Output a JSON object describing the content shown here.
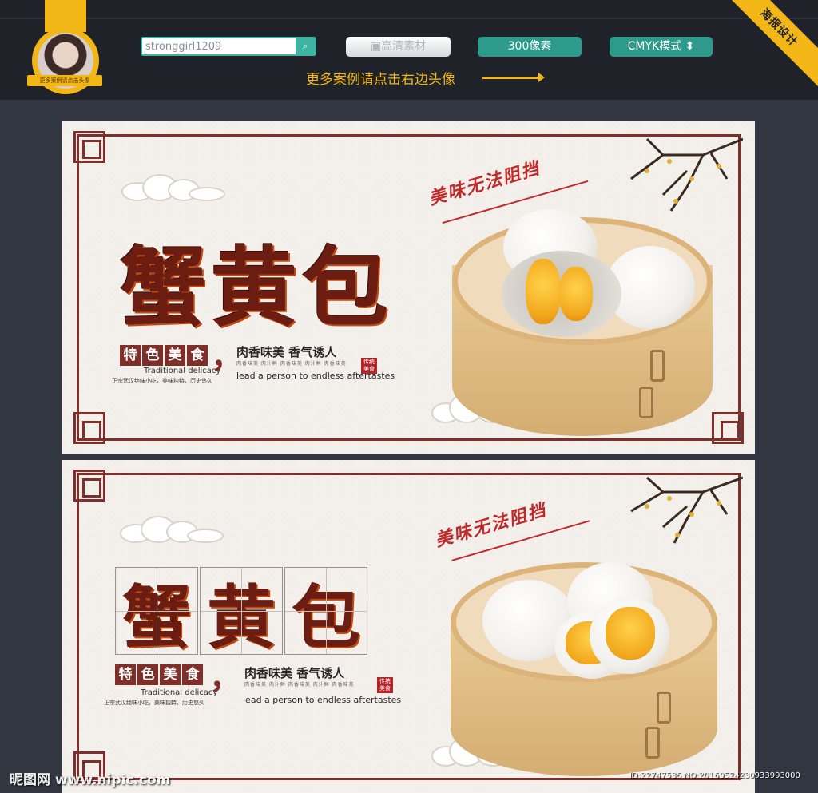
{
  "header": {
    "search": {
      "value": "stronggirl1209"
    },
    "badges": {
      "hd": "高清素材",
      "px": "300像素",
      "cmyk": "CMYK模式"
    },
    "more_text": "更多案例请点击右边头像",
    "corner_label": "海报设计",
    "avatar_caption": "更多案例请点击头像"
  },
  "poster": {
    "title_chars": [
      "蟹",
      "黄",
      "包"
    ],
    "tag_chars": [
      "特",
      "色",
      "美",
      "食"
    ],
    "tag_en": "Traditional delicacy",
    "tag_small": "正宗武汉绝味小吃，美味独特，历史悠久",
    "comma": "，",
    "slogan_cn": "肉香味美 香气诱人",
    "slogan_small": "肉香味美   肉汁鲜   肉香味美   肉汁鲜   肉香味美",
    "slogan_en": "lead a person to endless aftertastes",
    "seal_text": "传统美食",
    "calligraphy": "美味无法阻挡"
  },
  "footer": {
    "site": "昵图网 www.nipic.com",
    "id_text": "ID:22747536 NO:20160524230933993000"
  },
  "colors": {
    "accent": "#f2b616",
    "teal": "#2e9a8c",
    "frame": "#7f2f2a",
    "title": "#6b1d12"
  }
}
